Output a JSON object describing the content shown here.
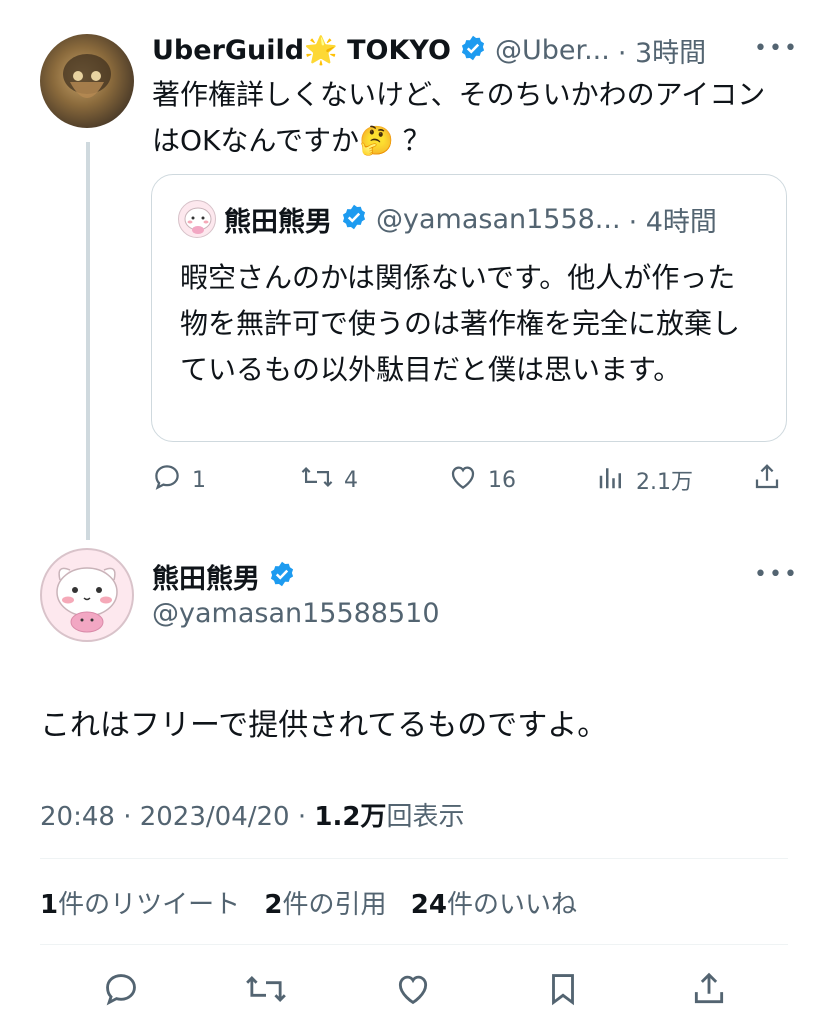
{
  "parent_tweet": {
    "display_name": "UberGuild🌟 TOKYO",
    "handle": "@Uber...",
    "time": "· 3時間",
    "text": "著作権詳しくないけど、そのちいかわのアイコンはOKなんですか🤔 ？",
    "quote": {
      "display_name": "熊田熊男",
      "handle": "@yamasan1558...",
      "time": "· 4時間",
      "text": "暇空さんのかは関係ないです。他人が作った物を無許可で使うのは著作権を完全に放棄しているもの以外駄目だと僕は思います。"
    },
    "actions": {
      "replies": "1",
      "retweets": "4",
      "likes": "16",
      "views": "2.1万"
    }
  },
  "main_tweet": {
    "display_name": "熊田熊男",
    "handle": "@yamasan15588510",
    "text": "これはフリーで提供されてるものですよ。",
    "timestamp": "20:48 · 2023/04/20 · ",
    "views_count": "1.2万",
    "views_label": "回表示",
    "stats": {
      "retweets_count": "1",
      "retweets_label": "件のリツイート",
      "quotes_count": "2",
      "quotes_label": "件の引用",
      "likes_count": "24",
      "likes_label": "件のいいね"
    }
  },
  "colors": {
    "verified": "#1d9bf0",
    "muted": "#536471",
    "border": "#cfd9de"
  },
  "icons": [
    "more-icon",
    "verified-icon",
    "reply-icon",
    "retweet-icon",
    "like-icon",
    "views-icon",
    "share-icon",
    "bookmark-icon"
  ]
}
